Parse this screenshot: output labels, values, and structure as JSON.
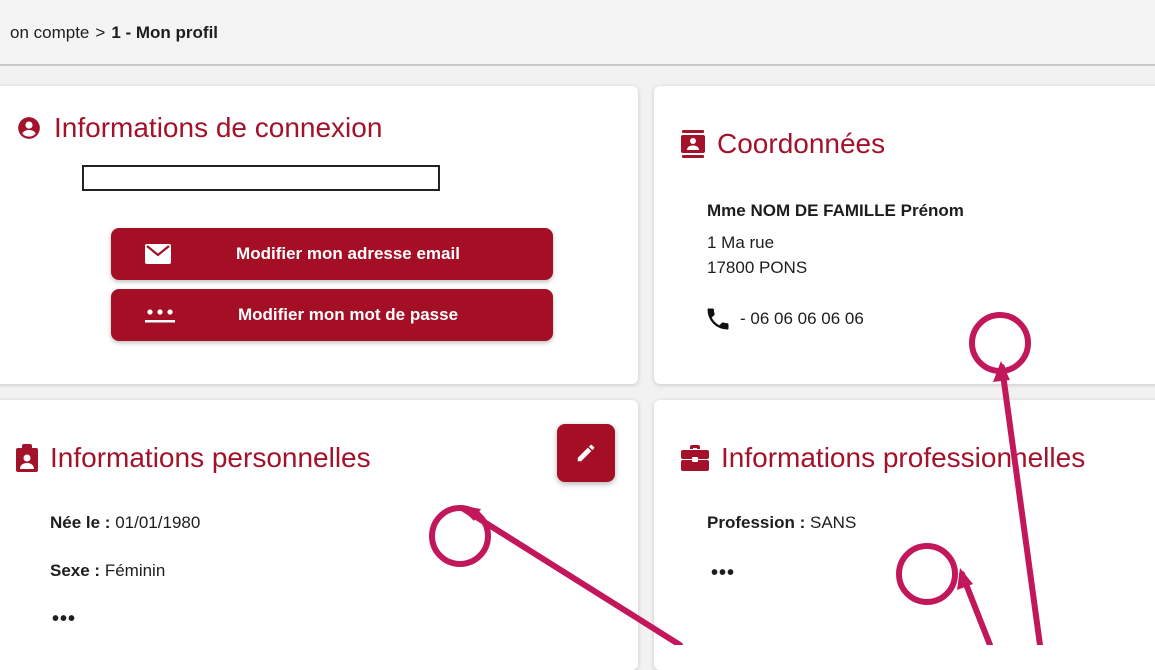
{
  "breadcrumb": {
    "parent": "on compte",
    "separator": ">",
    "current": "1 - Mon profil"
  },
  "connexion": {
    "title": "Informations de connexion",
    "email_button": "Modifier mon adresse email",
    "password_button": "Modifier mon mot de passe"
  },
  "coordonnees": {
    "title": "Coordonnées",
    "name": "Mme NOM DE FAMILLE Prénom",
    "address_line1": "1 Ma rue",
    "address_line2": "17800 PONS",
    "phone": "- 06 06 06 06 06"
  },
  "personnelles": {
    "title": "Informations personnelles",
    "birth_label": "Née le :",
    "birth_value": "01/01/1980",
    "sex_label": "Sexe :",
    "sex_value": "Féminin",
    "more": "•••"
  },
  "professionnelles": {
    "title": "Informations professionnelles",
    "profession_label": "Profession :",
    "profession_value": "SANS",
    "more": "•••"
  },
  "colors": {
    "accent": "#a3122a",
    "button": "#a50f25",
    "annotation": "#c2185b"
  }
}
